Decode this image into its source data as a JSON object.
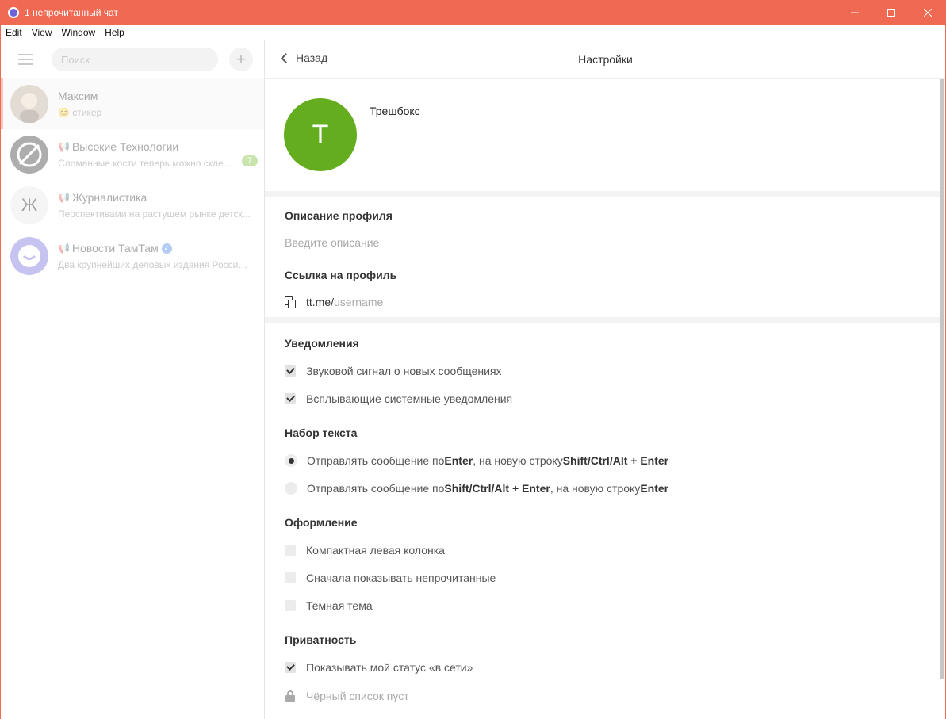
{
  "window": {
    "title": "1 непрочитанный чат"
  },
  "menu": [
    "Edit",
    "View",
    "Window",
    "Help"
  ],
  "sidebar": {
    "search_placeholder": "Поиск",
    "chats": [
      {
        "name": "Максим",
        "message": "😊 стикер",
        "channel": false
      },
      {
        "name": "Высокие Технологии",
        "message": "Сломанные кости теперь можно скле...",
        "channel": true,
        "unread": "7"
      },
      {
        "name": "Журналистика",
        "message": "Перспективами на растущем рынке детск...",
        "channel": true,
        "avatar_letter": "Ж"
      },
      {
        "name": "Новости ТамТам",
        "message": "Два крупнейших деловых издания России...",
        "channel": true,
        "verified": true
      }
    ]
  },
  "header": {
    "back_label": "Назад",
    "title": "Настройки"
  },
  "profile": {
    "avatar_letter": "Т",
    "name": "Трешбокс",
    "avatar_color": "#64ad1f"
  },
  "description": {
    "title": "Описание профиля",
    "placeholder": "Введите описание"
  },
  "link": {
    "title": "Ссылка на профиль",
    "prefix": "tt.me/",
    "placeholder": "username"
  },
  "notifications": {
    "title": "Уведомления",
    "items": [
      {
        "label": "Звуковой сигнал о новых сообщениях",
        "checked": true
      },
      {
        "label": "Всплывающие системные уведомления",
        "checked": true
      }
    ]
  },
  "typing": {
    "title": "Набор текста",
    "options": [
      {
        "parts": [
          "Отправлять сообщение по ",
          "Enter",
          ", на новую строку ",
          "Shift/Ctrl/Alt + Enter"
        ],
        "selected": true
      },
      {
        "parts": [
          "Отправлять сообщение по ",
          "Shift/Ctrl/Alt + Enter",
          ", на новую строку ",
          "Enter"
        ],
        "selected": false
      }
    ]
  },
  "appearance": {
    "title": "Оформление",
    "items": [
      {
        "label": "Компактная левая колонка",
        "checked": false
      },
      {
        "label": "Сначала показывать непрочитанные",
        "checked": false
      },
      {
        "label": "Темная тема",
        "checked": false
      }
    ]
  },
  "privacy": {
    "title": "Приватность",
    "items": [
      {
        "label": "Показывать мой статус «в сети»",
        "checked": true
      }
    ],
    "blacklist": "Чёрный список пуст"
  },
  "colors": {
    "titlebar": "#f06952",
    "accent_green": "#64ad1f",
    "tamtam_purple": "#6e63d8"
  }
}
